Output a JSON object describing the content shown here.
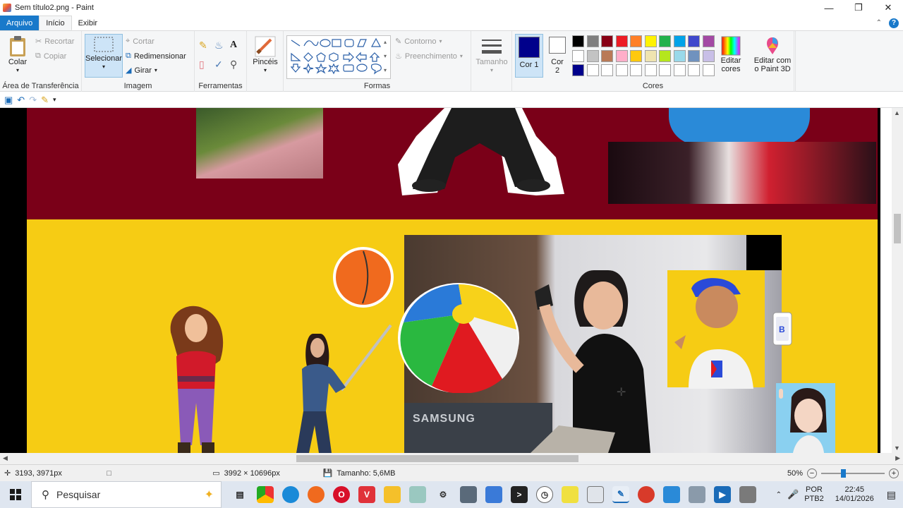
{
  "window": {
    "title": "Sem título2.png - Paint"
  },
  "tabs": {
    "file": "Arquivo",
    "home": "Início",
    "view": "Exibir"
  },
  "clipboard": {
    "paste": "Colar",
    "cut": "Recortar",
    "copy": "Copiar",
    "label": "Área de Transferência"
  },
  "image": {
    "select": "Selecionar",
    "crop": "Cortar",
    "resize": "Redimensionar",
    "rotate": "Girar",
    "label": "Imagem"
  },
  "tools": {
    "label": "Ferramentas"
  },
  "brushes": {
    "label": "Pincéis"
  },
  "shapes": {
    "outline": "Contorno",
    "fill": "Preenchimento",
    "label": "Formas"
  },
  "size": {
    "label": "Tamanho"
  },
  "colors": {
    "color1_label": "Cor 1",
    "color2_label": "Cor 2",
    "edit_label": "Editar cores",
    "label": "Cores",
    "paint3d_label": "Editar com o Paint 3D",
    "color1": "#00008b",
    "color2": "#ffffff",
    "palette_row1": [
      "#000000",
      "#7f7f7f",
      "#880015",
      "#ed1c24",
      "#ff7f27",
      "#fff200",
      "#22b14c",
      "#00a2e8",
      "#3f48cc",
      "#a349a4"
    ],
    "palette_row2": [
      "#ffffff",
      "#c3c3c3",
      "#b97a57",
      "#ffaec9",
      "#ffc90e",
      "#efe4b0",
      "#b5e61d",
      "#99d9ea",
      "#7092be",
      "#c8bfe7"
    ],
    "palette_row3": [
      "#00008b",
      "#ffffff",
      "#ffffff",
      "#ffffff",
      "#ffffff",
      "#ffffff",
      "#ffffff",
      "#ffffff",
      "#ffffff",
      "#ffffff"
    ]
  },
  "canvas": {
    "samsung_sign": "SAMSUNG",
    "top_band": "#7a0018",
    "bottom_band": "#f6cc14"
  },
  "status": {
    "cursor_pos": "3193, 3971px",
    "dimensions": "3992 × 10696px",
    "file_size": "Tamanho: 5,6MB",
    "zoom": "50%",
    "zoom_level": 0.5
  },
  "taskbar": {
    "search_placeholder": "Pesquisar",
    "lang1": "POR",
    "lang2": "PTB2",
    "time": "22:45",
    "date": "14/01/2026"
  }
}
